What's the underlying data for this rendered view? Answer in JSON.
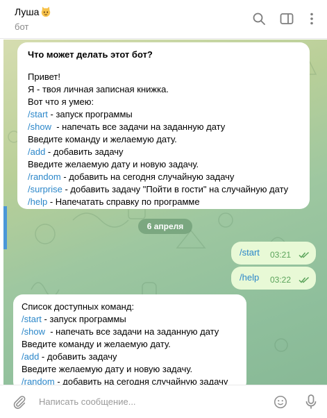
{
  "header": {
    "title": "Луша",
    "subtitle": "бот",
    "icons": [
      "search-icon",
      "sidebar-toggle-icon",
      "more-vertical-icon"
    ]
  },
  "messages": {
    "bot_intro": {
      "heading": "Что может делать этот бот?",
      "line1": "Привет!",
      "line2": "Я - твоя личная записная книжка.",
      "line3": "Вот что я умею:",
      "l4_cmd": "/start",
      "l4_text": " - запуск программы",
      "l5_cmd": "/show",
      "l5_text": "  - напечать все задачи на заданную дату",
      "line6": "Введите команду и желаемую дату.",
      "l7_cmd": "/add",
      "l7_text": " - добавить задачу",
      "line8": "Введите желаемую дату и новую задачу.",
      "l9_cmd": "/random",
      "l9_text": " - добавить на сегодня случайную задачу",
      "l10_cmd": "/surprise",
      "l10_text": " - добавить задачу \"Пойти в гости\" на случайную дату",
      "l11_cmd": "/help",
      "l11_text": " - Напечатать справку по программе"
    },
    "date_separator": "6 апреля",
    "outgoing": [
      {
        "text": "/start",
        "time": "03:21"
      },
      {
        "text": "/help",
        "time": "03:22"
      }
    ],
    "bot_help": {
      "line1": "Список доступных команд:",
      "l2_cmd": "/start",
      "l2_text": " - запуск программы",
      "l3_cmd": "/show",
      "l3_text": "  - напечать все задачи на заданную дату",
      "line4": "Введите команду и желаемую дату.",
      "l5_cmd": "/add",
      "l5_text": " - добавить задачу",
      "line6": "Введите желаемую дату и новую задачу.",
      "l7_cmd": "/random",
      "l7_text": " - добавить на сегодня случайную задачу"
    }
  },
  "composer": {
    "placeholder": "Написать сообщение..."
  },
  "colors": {
    "link": "#2a86c9",
    "outgoing_bubble": "#e8f9d6",
    "read_ticks": "#5aa35a",
    "accent": "#4a97d8"
  }
}
